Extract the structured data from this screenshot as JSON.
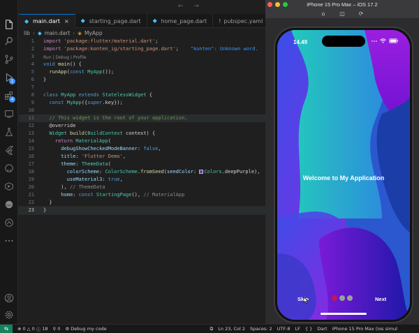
{
  "tabs": [
    {
      "label": "main.dart",
      "kind": "dart",
      "active": true
    },
    {
      "label": "starting_page.dart",
      "kind": "dart",
      "active": false
    },
    {
      "label": "home_page.dart",
      "kind": "dart",
      "active": false
    },
    {
      "label": "pubspec.yaml",
      "kind": "yaml",
      "active": false
    }
  ],
  "breadcrumb": {
    "folder": "lib",
    "file": "main.dart",
    "symbol": "MyApp"
  },
  "codelens": {
    "run_debug_profile": "Run | Debug | Profile"
  },
  "code": {
    "l1": {
      "n": "1",
      "a": "import ",
      "b": "'package:flutter/material.dart'",
      "c": ";"
    },
    "l2": {
      "n": "2",
      "a": "import ",
      "b": "'package:konten_ig/starting_page.dart'",
      "c": ";",
      "d": "\"konten\": Unknown word."
    },
    "l3": {
      "n": "3"
    },
    "l4": {
      "n": "4",
      "a": "void ",
      "b": "main",
      "c": "() {"
    },
    "l5": {
      "n": "5",
      "a": "  ",
      "b": "runApp",
      "c": "(",
      "d": "const ",
      "e": "MyApp",
      "f": "());"
    },
    "l6": {
      "n": "6",
      "a": "}"
    },
    "l7": {
      "n": "7"
    },
    "l8": {
      "n": "8",
      "a": "class ",
      "b": "MyApp ",
      "c": "extends ",
      "d": "StatelessWidget",
      "e": " {"
    },
    "l9": {
      "n": "9",
      "a": "  ",
      "b": "const ",
      "c": "MyApp",
      "d": "({",
      "e": "super",
      "f": ".key});"
    },
    "l10": {
      "n": "10"
    },
    "l11": {
      "n": "11",
      "a": "  // This widget is the root of your application."
    },
    "l12": {
      "n": "12",
      "a": "  @override"
    },
    "l13": {
      "n": "13",
      "a": "  ",
      "b": "Widget ",
      "c": "build",
      "d": "(",
      "e": "BuildContext ",
      "f": "context) {"
    },
    "l14": {
      "n": "14",
      "a": "    ",
      "b": "return ",
      "c": "MaterialApp",
      "d": "("
    },
    "l15": {
      "n": "15",
      "a": "      ",
      "b": "debugShowCheckedModeBanner",
      "c": ": ",
      "d": "false",
      "e": ","
    },
    "l16": {
      "n": "16",
      "a": "      ",
      "b": "title",
      "c": ": ",
      "d": "'Flutter Demo'",
      "e": ","
    },
    "l17": {
      "n": "17",
      "a": "      ",
      "b": "theme",
      "c": ": ",
      "d": "ThemeData",
      "e": "("
    },
    "l18": {
      "n": "18",
      "a": "        ",
      "b": "colorScheme",
      "c": ": ",
      "d": "ColorScheme",
      "e": ".",
      "f": "fromSeed",
      "g": "(",
      "h": "seedColor",
      "i": ": ",
      "j": "Colors",
      "k": ".deepPurple),"
    },
    "l19": {
      "n": "19",
      "a": "        ",
      "b": "useMaterial3",
      "c": ": ",
      "d": "true",
      "e": ","
    },
    "l20": {
      "n": "20",
      "a": "      ), ",
      "b": "// ThemeData"
    },
    "l21": {
      "n": "21",
      "a": "      ",
      "b": "home",
      "c": ": ",
      "d": "const ",
      "e": "StartingPage",
      "f": "(), ",
      "g": "// MaterialApp"
    },
    "l22": {
      "n": "22",
      "a": "  }"
    },
    "l23": {
      "n": "23",
      "a": "}"
    }
  },
  "statusbar": {
    "remote": "⇆",
    "problems_errors": "0",
    "problems_warnings": "0",
    "problems_info": "18",
    "ports": "0",
    "debug": "Debug my code",
    "position": "Ln 23, Col 2",
    "spaces": "Spaces: 2",
    "encoding": "UTF-8",
    "eol": "LF",
    "braces": "{ }",
    "language": "Dart",
    "device": "iPhone 15 Pro Max (ios simul"
  },
  "simulator": {
    "title": "iPhone 15 Pro Max – iOS 17.2",
    "time": "14.49",
    "welcome": "Welcome to My Application",
    "skip": "Skip",
    "next": "Next",
    "dots_total": 3,
    "dots_active_index": 0
  },
  "colors": {
    "accent": "#0078d4",
    "remote": "#16825d",
    "dot_active": "#c2185b",
    "dot_inactive": "#9e9e9e"
  }
}
